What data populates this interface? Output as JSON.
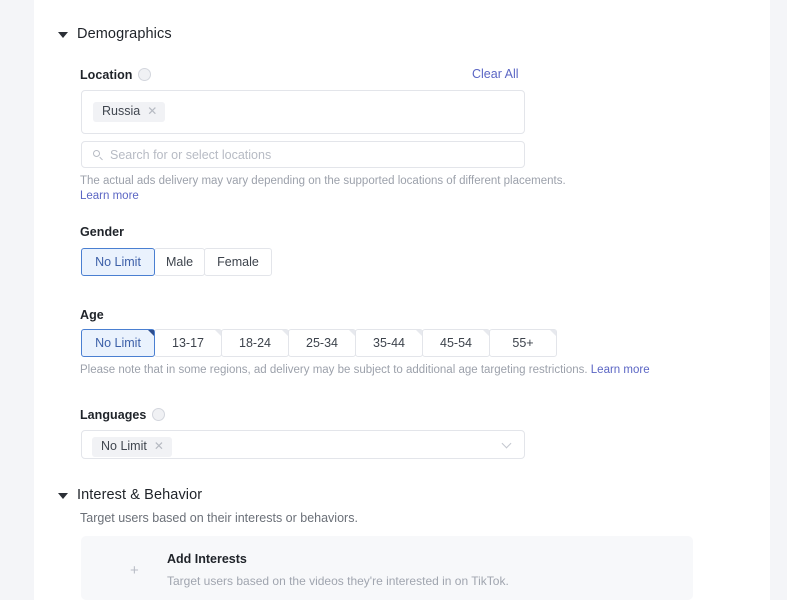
{
  "sections": {
    "demographics": {
      "title": "Demographics",
      "caret_icon": "caret-down-icon"
    },
    "interest": {
      "title": "Interest & Behavior",
      "caret_icon": "caret-down-icon",
      "description": "Target users based on their interests or behaviors.",
      "card": {
        "plus_icon": "plus-icon",
        "title": "Add Interests",
        "subtitle": "Target users based on the videos they're interested in on TikTok."
      }
    }
  },
  "location": {
    "label": "Location",
    "info_icon": "info-icon",
    "clear_all": "Clear All",
    "tags": [
      {
        "label": "Russia",
        "remove_icon": "close-icon"
      }
    ],
    "search_icon": "search-icon",
    "search_placeholder": "Search for or select locations",
    "helper_text": "The actual ads delivery may vary depending on the supported locations of different placements.",
    "helper_link": "Learn more"
  },
  "gender": {
    "label": "Gender",
    "options": [
      {
        "label": "No Limit",
        "selected": true
      },
      {
        "label": "Male",
        "selected": false
      },
      {
        "label": "Female",
        "selected": false
      }
    ]
  },
  "age": {
    "label": "Age",
    "options": [
      {
        "label": "No Limit",
        "selected": true
      },
      {
        "label": "13-17",
        "selected": false
      },
      {
        "label": "18-24",
        "selected": false
      },
      {
        "label": "25-34",
        "selected": false
      },
      {
        "label": "35-44",
        "selected": false
      },
      {
        "label": "45-54",
        "selected": false
      },
      {
        "label": "55+",
        "selected": false
      }
    ],
    "helper_text": "Please note that in some regions, ad delivery may be subject to additional age targeting restrictions.",
    "helper_link": "Learn more"
  },
  "languages": {
    "label": "Languages",
    "info_icon": "info-icon",
    "tags": [
      {
        "label": "No Limit",
        "remove_icon": "close-icon"
      }
    ],
    "dropdown_icon": "chevron-down-icon"
  },
  "colors": {
    "accent_link": "#5b66c4",
    "selected_bg": "#eaf2fd",
    "selected_border": "#4a7fd1",
    "page_bg": "#f3f4f7",
    "card_bg": "#ffffff"
  }
}
